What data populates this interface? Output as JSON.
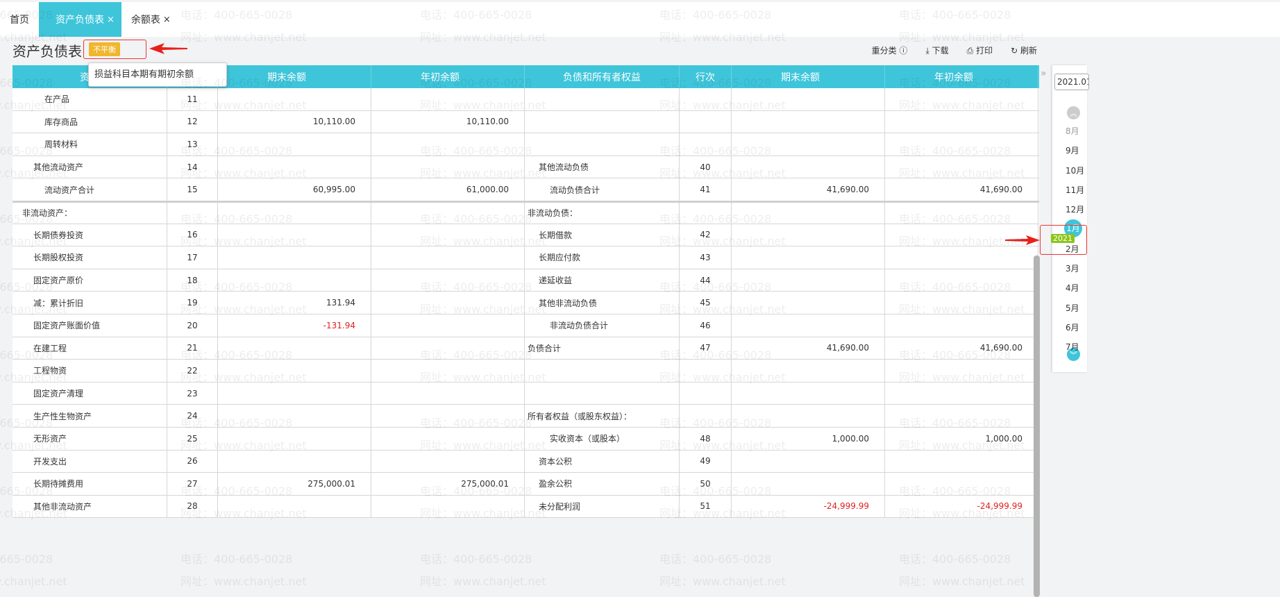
{
  "tabs": [
    {
      "label": "首页"
    },
    {
      "label": "资产负债表",
      "close": "×"
    },
    {
      "label": "余额表",
      "close": "×"
    }
  ],
  "page_title": "资产负债表",
  "status_badge": "不平衡",
  "tooltip": "损益科目本期有期初余额",
  "toolbar": {
    "reclassify": "重分类",
    "download": "下载",
    "print": "打印",
    "refresh": "刷新"
  },
  "headers": [
    "资产",
    "行次",
    "期末余额",
    "年初余额",
    "负债和所有者权益",
    "行次",
    "期末余额",
    "年初余额"
  ],
  "rows": [
    [
      "在产品",
      "11",
      "",
      "",
      "",
      "",
      "",
      ""
    ],
    [
      "库存商品",
      "12",
      "10,110.00",
      "10,110.00",
      "",
      "",
      "",
      ""
    ],
    [
      "周转材料",
      "13",
      "",
      "",
      "",
      "",
      "",
      ""
    ],
    [
      "其他流动资产",
      "14",
      "",
      "",
      "其他流动负债",
      "40",
      "",
      ""
    ],
    [
      "流动资产合计",
      "15",
      "60,995.00",
      "61,000.00",
      "流动负债合计",
      "41",
      "41,690.00",
      "41,690.00"
    ],
    [
      "非流动资产：",
      "",
      "",
      "",
      "非流动负债：",
      "",
      "",
      ""
    ],
    [
      "长期债券投资",
      "16",
      "",
      "",
      "长期借款",
      "42",
      "",
      ""
    ],
    [
      "长期股权投资",
      "17",
      "",
      "",
      "长期应付款",
      "43",
      "",
      ""
    ],
    [
      "固定资产原价",
      "18",
      "",
      "",
      "递延收益",
      "44",
      "",
      ""
    ],
    [
      "减：累计折旧",
      "19",
      "131.94",
      "",
      "其他非流动负债",
      "45",
      "",
      ""
    ],
    [
      "固定资产账面价值",
      "20",
      "-131.94",
      "",
      "非流动负债合计",
      "46",
      "",
      ""
    ],
    [
      "在建工程",
      "21",
      "",
      "",
      "负债合计",
      "47",
      "41,690.00",
      "41,690.00"
    ],
    [
      "工程物资",
      "22",
      "",
      "",
      "",
      "",
      "",
      ""
    ],
    [
      "固定资产清理",
      "23",
      "",
      "",
      "",
      "",
      "",
      ""
    ],
    [
      "生产性生物资产",
      "24",
      "",
      "",
      "所有者权益（或股东权益）：",
      "",
      "",
      ""
    ],
    [
      "无形资产",
      "25",
      "",
      "",
      "实收资本（或股本）",
      "48",
      "1,000.00",
      "1,000.00"
    ],
    [
      "开发支出",
      "26",
      "",
      "",
      "资本公积",
      "49",
      "",
      ""
    ],
    [
      "长期待摊费用",
      "27",
      "275,000.01",
      "275,000.01",
      "盈余公积",
      "50",
      "",
      ""
    ],
    [
      "其他非流动资产",
      "28",
      "",
      "",
      "未分配利润",
      "51",
      "-24,999.99",
      "-24,999.99"
    ]
  ],
  "period": {
    "value": "2021.01",
    "year_badge": "2021",
    "months": [
      "8月",
      "9月",
      "10月",
      "11月",
      "12月",
      "1月",
      "2月",
      "3月",
      "4月",
      "5月",
      "6月",
      "7月"
    ],
    "selected": "1月"
  },
  "watermark": {
    "phone": "电话：400-665-0028",
    "site": "网址：www.chanjet.net"
  },
  "colors": {
    "accent": "#3ec5da",
    "badge": "#f0b62e",
    "negative": "#e02020",
    "year_badge": "#8cc51a"
  }
}
